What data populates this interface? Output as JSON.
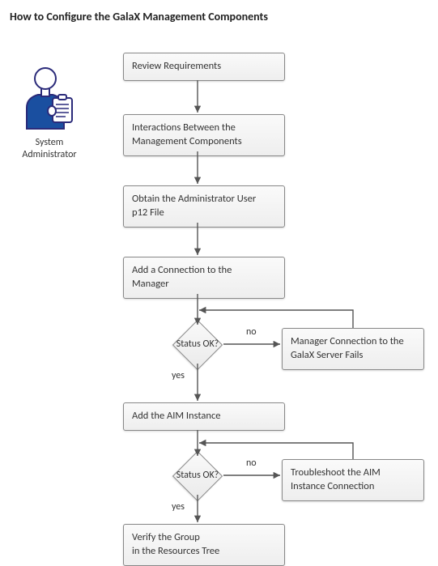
{
  "title": "How to Configure the GalaX Management Components",
  "actor": {
    "role_line1": "System",
    "role_line2": "Administrator"
  },
  "steps": {
    "review": "Review Requirements",
    "interactions_line1": "Interactions Between the",
    "interactions_line2": "Management Components",
    "obtain_line1": "Obtain the Administrator User",
    "obtain_line2": "p12 File",
    "add_conn_line1": "Add a Connection to the",
    "add_conn_line2": "Manager",
    "fail_conn_line1": "Manager Connection to the",
    "fail_conn_line2": "GalaX Server Fails",
    "add_aim": "Add the AIM Instance",
    "troubleshoot_line1": "Troubleshoot the AIM",
    "troubleshoot_line2": "Instance Connection",
    "verify_line1": "Verify the Group",
    "verify_line2": "in the Resources Tree"
  },
  "decisions": {
    "status1": "Status OK?",
    "status2": "Status OK?"
  },
  "labels": {
    "yes1": "yes",
    "no1": "no",
    "yes2": "yes",
    "no2": "no"
  },
  "chart_data": {
    "type": "flowchart",
    "actor": "System Administrator",
    "nodes": [
      {
        "id": "review",
        "type": "process",
        "label": "Review Requirements"
      },
      {
        "id": "interactions",
        "type": "process",
        "label": "Interactions Between the Management Components"
      },
      {
        "id": "obtain",
        "type": "process",
        "label": "Obtain the Administrator User p12 File"
      },
      {
        "id": "add_conn",
        "type": "process",
        "label": "Add a Connection to the Manager"
      },
      {
        "id": "status1",
        "type": "decision",
        "label": "Status OK?"
      },
      {
        "id": "fail_conn",
        "type": "process",
        "label": "Manager Connection to the GalaX Server Fails"
      },
      {
        "id": "add_aim",
        "type": "process",
        "label": "Add the AIM Instance"
      },
      {
        "id": "status2",
        "type": "decision",
        "label": "Status OK?"
      },
      {
        "id": "troubleshoot",
        "type": "process",
        "label": "Troubleshoot the AIM Instance Connection"
      },
      {
        "id": "verify",
        "type": "process",
        "label": "Verify the Group in the Resources Tree"
      }
    ],
    "edges": [
      {
        "from": "review",
        "to": "interactions"
      },
      {
        "from": "interactions",
        "to": "obtain"
      },
      {
        "from": "obtain",
        "to": "add_conn"
      },
      {
        "from": "add_conn",
        "to": "status1"
      },
      {
        "from": "status1",
        "to": "add_aim",
        "label": "yes"
      },
      {
        "from": "status1",
        "to": "fail_conn",
        "label": "no"
      },
      {
        "from": "fail_conn",
        "to": "status1",
        "loop_back": true
      },
      {
        "from": "add_aim",
        "to": "status2"
      },
      {
        "from": "status2",
        "to": "verify",
        "label": "yes"
      },
      {
        "from": "status2",
        "to": "troubleshoot",
        "label": "no"
      },
      {
        "from": "troubleshoot",
        "to": "status2",
        "loop_back": true
      }
    ]
  }
}
